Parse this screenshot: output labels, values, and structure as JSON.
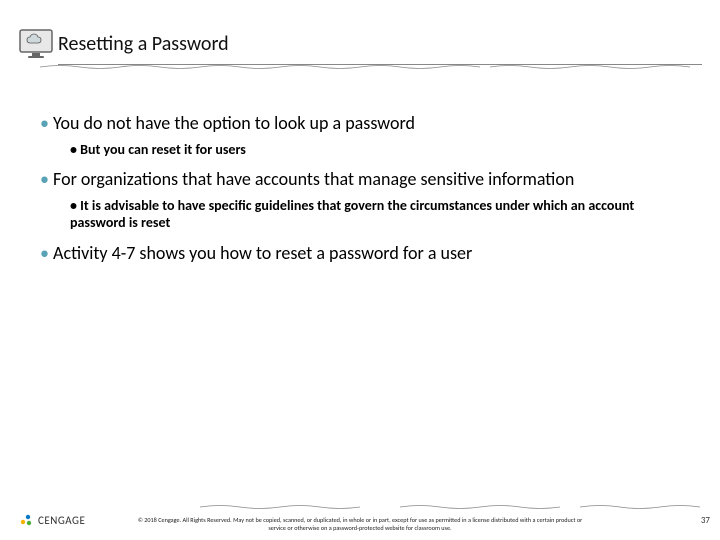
{
  "title": "Resetting a Password",
  "bullets": {
    "b1": "You do not have the option to look up a password",
    "b1a": "But you can reset it for users",
    "b2": "For organizations that have accounts that manage sensitive information",
    "b2a": "It is advisable to have specific guidelines that govern the circumstances under which an account password is reset",
    "b3": "Activity 4-7 shows you how to reset a password for a user"
  },
  "brand": "CENGAGE",
  "copyright": "© 2018 Cengage. All Rights Reserved. May not be copied, scanned, or duplicated, in whole or in part, except for use as permitted in a license distributed with a certain product or service or otherwise on a password-protected website for classroom use.",
  "page": "37",
  "colors": {
    "accent": "#5aa2b6"
  }
}
